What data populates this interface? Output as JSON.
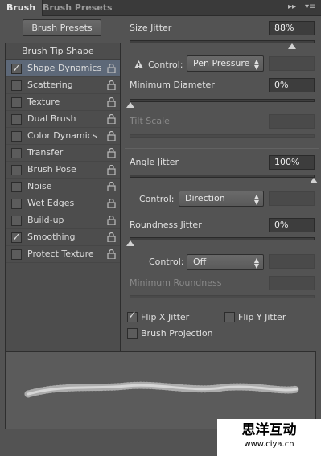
{
  "tabs": {
    "active": "Brush",
    "inactive": "Brush Presets"
  },
  "presets_button": "Brush Presets",
  "list": {
    "header": "Brush Tip Shape",
    "items": [
      {
        "label": "Shape Dynamics",
        "checked": true,
        "selected": true
      },
      {
        "label": "Scattering",
        "checked": false
      },
      {
        "label": "Texture",
        "checked": false
      },
      {
        "label": "Dual Brush",
        "checked": false
      },
      {
        "label": "Color Dynamics",
        "checked": false
      },
      {
        "label": "Transfer",
        "checked": false
      },
      {
        "label": "Brush Pose",
        "checked": false
      },
      {
        "label": "Noise",
        "checked": false
      },
      {
        "label": "Wet Edges",
        "checked": false
      },
      {
        "label": "Build-up",
        "checked": false
      },
      {
        "label": "Smoothing",
        "checked": true
      },
      {
        "label": "Protect Texture",
        "checked": false
      }
    ]
  },
  "controls": {
    "size_jitter": {
      "label": "Size Jitter",
      "value": "88%",
      "fraction": 0.88
    },
    "size_control": {
      "label": "Control:",
      "value": "Pen Pressure"
    },
    "min_diameter": {
      "label": "Minimum Diameter",
      "value": "0%",
      "fraction": 0
    },
    "tilt_scale": {
      "label": "Tilt Scale"
    },
    "angle_jitter": {
      "label": "Angle Jitter",
      "value": "100%",
      "fraction": 1.0
    },
    "angle_control": {
      "label": "Control:",
      "value": "Direction"
    },
    "roundness_jitter": {
      "label": "Roundness Jitter",
      "value": "0%",
      "fraction": 0
    },
    "roundness_control": {
      "label": "Control:",
      "value": "Off"
    },
    "min_roundness": {
      "label": "Minimum Roundness"
    },
    "flip_x": {
      "label": "Flip X Jitter",
      "checked": true
    },
    "flip_y": {
      "label": "Flip Y Jitter",
      "checked": false
    },
    "projection": {
      "label": "Brush Projection",
      "checked": false
    }
  },
  "watermark": {
    "title": "思洋互动",
    "url": "www.ciya.cn"
  },
  "icons": {
    "lock": "lock-icon",
    "warning": "warning-icon",
    "panel_menu": "panel-menu-icon",
    "collapse": "collapse-icon"
  }
}
